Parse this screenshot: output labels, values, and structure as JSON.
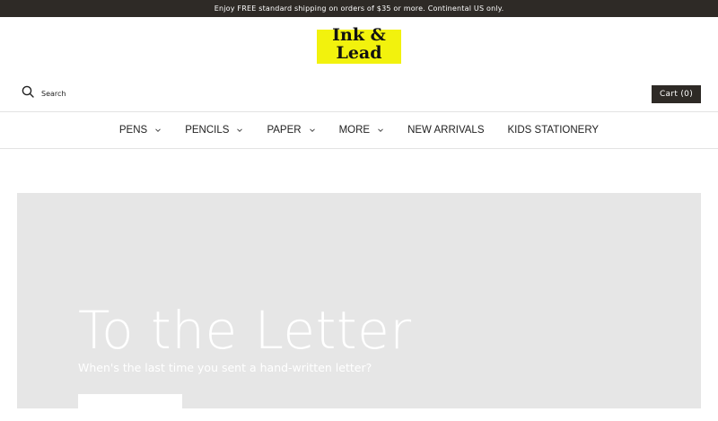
{
  "announcement": {
    "text": "Enjoy FREE standard shipping on orders of $35 or more. Continental US only."
  },
  "logo": {
    "line1": "Ink &",
    "line2": "Lead",
    "color": "#f2f20d"
  },
  "header": {
    "search_label": "Search",
    "search_icon": "search-icon",
    "cart_label": "Cart (0)"
  },
  "nav": {
    "items": [
      {
        "label": "PENS",
        "has_dropdown": true
      },
      {
        "label": "PENCILS",
        "has_dropdown": true
      },
      {
        "label": "PAPER",
        "has_dropdown": true
      },
      {
        "label": "MORE",
        "has_dropdown": true
      },
      {
        "label": "NEW ARRIVALS",
        "has_dropdown": false
      },
      {
        "label": "KIDS STATIONERY",
        "has_dropdown": false
      }
    ]
  },
  "hero": {
    "title": "To the Letter",
    "subtitle": "When's the last time you sent a hand-written letter?",
    "background": "#e6e6e6"
  },
  "colors": {
    "dark": "#2e2a26",
    "accent": "#f2f20d"
  }
}
